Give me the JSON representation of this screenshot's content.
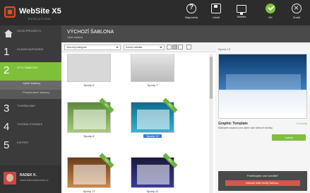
{
  "app": {
    "logo": "WebSite X5",
    "logo_sub": "EVOLUTION"
  },
  "toolbar": [
    {
      "label": "Nápověda",
      "icon": "help-icon"
    },
    {
      "label": "Uložit",
      "icon": "save-icon"
    },
    {
      "label": "Náhled",
      "icon": "preview-icon"
    },
    {
      "label": "OK",
      "icon": "ok-icon"
    },
    {
      "label": "Zrušit",
      "icon": "close-icon"
    }
  ],
  "sidebar": {
    "home_label": "ÚVOD PROJEKTU",
    "steps": [
      {
        "num": "1",
        "label": "HLAVNÍ NASTAVENÍ"
      },
      {
        "num": "2",
        "label": "STYL ŠABLONY"
      },
      {
        "num": "3",
        "label": "TVORBA MAP"
      },
      {
        "num": "4",
        "label": "TVORBA STRÁNEK"
      },
      {
        "num": "5",
        "label": "EXPORT"
      }
    ],
    "subs": [
      "Výběr šablony",
      "Přizpůsobení šablony"
    ],
    "user": {
      "name": "RADEK K.",
      "email": "radek.kulmer@seznam.cz"
    }
  },
  "main": {
    "title": "VÝCHOZÍ ŠABLONA",
    "subtitle": "Výběr šablony",
    "filter_category": "Všechny kategorie",
    "filter_sort": "Scéná nabídka",
    "templates": [
      {
        "name": "Sporty 6",
        "badge": ""
      },
      {
        "name": "Sporty 7",
        "badge": ""
      },
      {
        "name": "Sporty 8",
        "badge": "NEW"
      },
      {
        "name": "Sporty 13",
        "badge": "NEW"
      },
      {
        "name": "Sporty 17",
        "badge": "NEW"
      },
      {
        "name": "Sporty 21",
        "badge": "NEW"
      }
    ],
    "selected_index": 3
  },
  "preview": {
    "title": "Sporty 13",
    "name": "Graphic Template",
    "kredit": "3 kredity",
    "desc": "Stahujete snpassu pro výběr vaší webové stránky",
    "button": "Vybrat",
    "footer_q": "Potřebujete více kreditů?",
    "footer_link": "Zakoupit další kredity šablony..."
  }
}
